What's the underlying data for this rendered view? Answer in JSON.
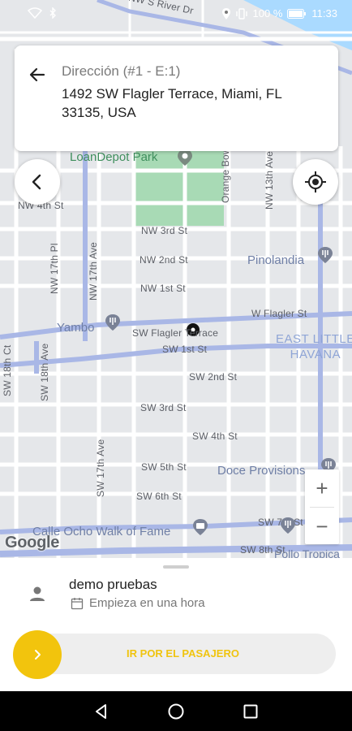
{
  "status_bar": {
    "battery_text": "100 %",
    "time": "11:33"
  },
  "address_card": {
    "label": "Dirección (#1 - E:1)",
    "value": "1492 SW Flagler Terrace, Miami, FL 33135, USA"
  },
  "map": {
    "streets": {
      "nw_s_river_dr": "NW S River Dr",
      "nw_4th_st": "NW 4th St",
      "nw_3rd_st": "NW 3rd St",
      "nw_2nd_st": "NW 2nd St",
      "nw_1st_st": "NW 1st St",
      "w_flagler_st": "W Flagler St",
      "sw_flagler_terrace": "SW Flagler Terrace",
      "sw_1st_st": "SW 1st St",
      "sw_2nd_st": "SW 2nd St",
      "sw_3rd_st": "SW 3rd St",
      "sw_4th_st": "SW 4th St",
      "sw_5th_st": "SW 5th St",
      "sw_6th_st": "SW 6th St",
      "sw_7th_st": "SW 7th St",
      "sw_8th_st": "SW 8th St",
      "nw_17th_pl": "NW 17th Pl",
      "nw_17th_ave": "NW 17th Ave",
      "nw_13th_ave": "NW 13th Ave",
      "orange_bowl": "Orange Bow",
      "sw_18th_ct": "SW 18th Ct",
      "sw_18th_ave": "SW 18th Ave",
      "sw_17th_ave": "SW 17th Ave"
    },
    "pois": {
      "loandepot": "LoanDepot Park",
      "pinolandia": "Pinolandia",
      "yambo": "Yambo",
      "east_little_havana": "EAST LITTLE\nHAVANA",
      "doce_provisions": "Doce Provisions",
      "calle_ocho": "Calle Ocho Walk of Fame",
      "pollo_tropical": "Pollo Tropica"
    },
    "attribution": "Google",
    "zoom_in": "+",
    "zoom_out": "−"
  },
  "trip": {
    "passenger_name": "demo pruebas",
    "start_text": "Empieza en una hora",
    "action_label": "IR POR EL PASAJERO"
  },
  "colors": {
    "accent_yellow": "#f2c40d",
    "map_bg": "#e5e7ea",
    "park_green": "#a8dab5",
    "main_road": "#a9b7e6",
    "water": "#aadaff"
  }
}
